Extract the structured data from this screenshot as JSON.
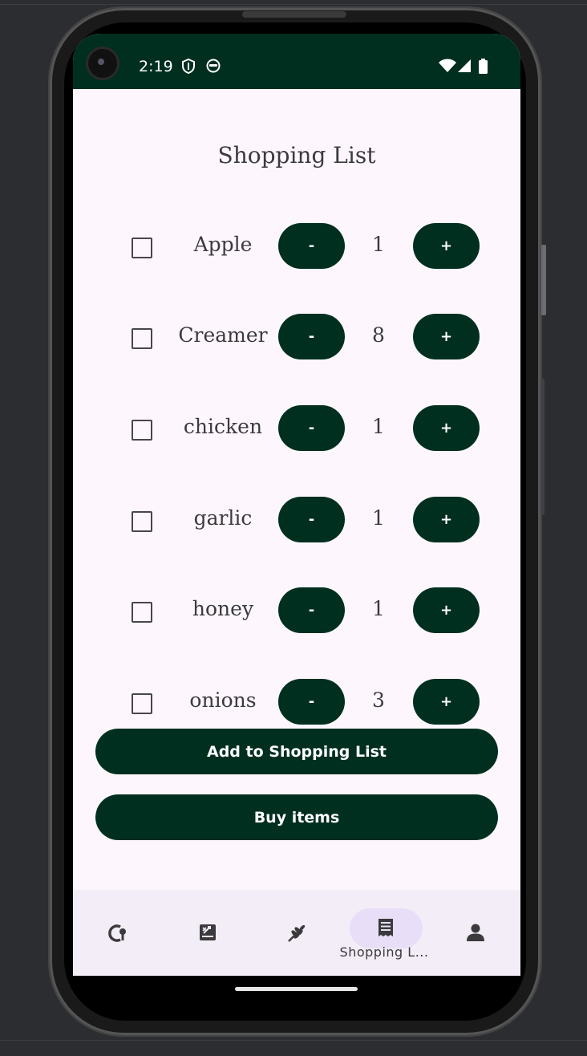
{
  "status_bar": {
    "time": "2:19",
    "icons": [
      "shield-icon",
      "face-icon",
      "wifi-icon",
      "signal-icon",
      "battery-icon"
    ]
  },
  "screen": {
    "title": "Shopping List",
    "items": [
      {
        "name": "Apple",
        "quantity": "1",
        "checked": false,
        "minus": "-",
        "plus": "+"
      },
      {
        "name": "Creamer",
        "quantity": "8",
        "checked": false,
        "minus": "-",
        "plus": "+"
      },
      {
        "name": "chicken",
        "quantity": "1",
        "checked": false,
        "minus": "-",
        "plus": "+"
      },
      {
        "name": "garlic",
        "quantity": "1",
        "checked": false,
        "minus": "-",
        "plus": "+"
      },
      {
        "name": "honey",
        "quantity": "1",
        "checked": false,
        "minus": "-",
        "plus": "+"
      },
      {
        "name": "onions",
        "quantity": "3",
        "checked": false,
        "minus": "-",
        "plus": "+"
      }
    ],
    "add_button": "Add to Shopping List",
    "buy_button": "Buy items"
  },
  "bottom_nav": {
    "items": [
      {
        "icon": "recipe-search-icon"
      },
      {
        "icon": "scale-icon"
      },
      {
        "icon": "grain-icon"
      },
      {
        "icon": "receipt-list-icon",
        "label": "Shopping L...",
        "selected": true
      },
      {
        "icon": "person-icon"
      }
    ]
  },
  "colors": {
    "primary": "#002f1f",
    "background": "#fdf7fd",
    "nav_background": "#f3edf7",
    "nav_indicator": "#e8def8",
    "text": "#3b3a3d"
  }
}
